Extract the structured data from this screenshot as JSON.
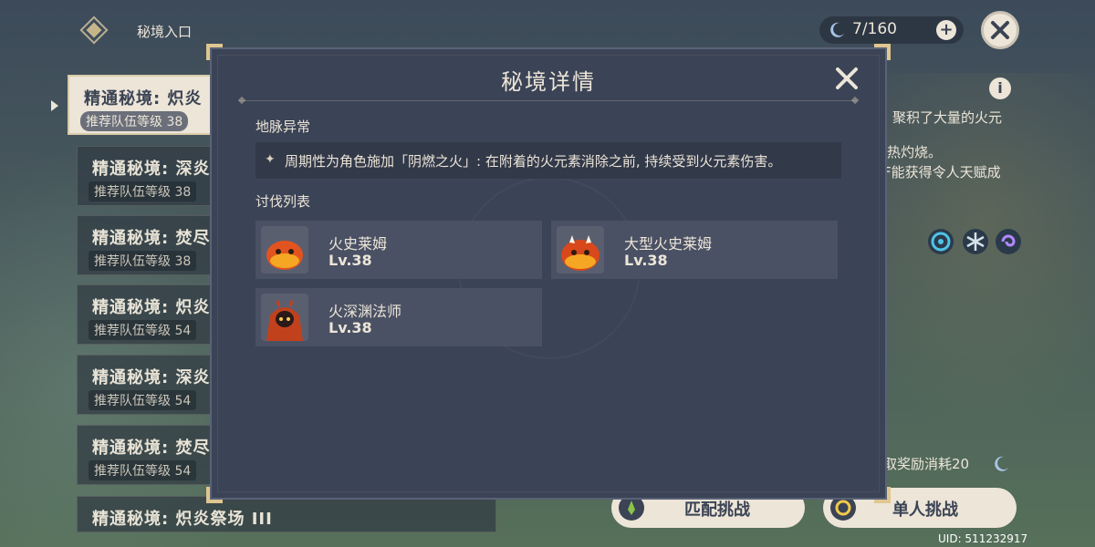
{
  "header": {
    "title": "秘境入口",
    "resin_count": "7/160",
    "add_label": "+"
  },
  "domain_list": [
    {
      "name": "精通秘境: 炽炎",
      "level": "推荐队伍等级 38",
      "selected": true
    },
    {
      "name": "精通秘境: 深炎",
      "level": "推荐队伍等级 38"
    },
    {
      "name": "精通秘境: 焚尽",
      "level": "推荐队伍等级 38"
    },
    {
      "name": "精通秘境: 炽炎",
      "level": "推荐队伍等级 54"
    },
    {
      "name": "精通秘境: 深炎",
      "level": "推荐队伍等级 54"
    },
    {
      "name": "精通秘境: 焚尽",
      "level": "推荐队伍等级 54"
    },
    {
      "name": "精通秘境: 炽炎祭场 III",
      "level": ""
    }
  ],
  "right_panel": {
    "info_label": "i",
    "desc_line1": "聚积了大量的火元",
    "desc_line2": "热灼烧。",
    "desc_line3": "F能获得令人天赋成",
    "reward_text": "取奖励消耗20",
    "coop_button": "匹配挑战",
    "solo_button": "单人挑战",
    "uid": "UID: 511232917"
  },
  "modal": {
    "title": "秘境详情",
    "ley_section_label": "地脉异常",
    "ley_text": "周期性为角色施加「阴燃之火」: 在附着的火元素消除之前, 持续受到火元素伤害。",
    "enemy_section_label": "讨伐列表",
    "enemies": [
      {
        "name": "火史莱姆",
        "level": "Lv.38",
        "icon": "fire-slime-icon"
      },
      {
        "name": "大型火史莱姆",
        "level": "Lv.38",
        "icon": "large-fire-slime-icon"
      },
      {
        "name": "火深渊法师",
        "level": "Lv.38",
        "icon": "pyro-abyss-mage-icon"
      }
    ]
  },
  "colors": {
    "modal_bg": "#3b4356",
    "cream": "#ece5d8",
    "gold_corner": "#e0c690",
    "dark_text": "#3b4354"
  }
}
